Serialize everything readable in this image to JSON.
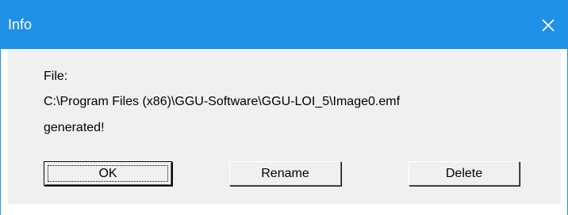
{
  "dialog": {
    "title": "Info",
    "close_icon": "close-icon",
    "message": {
      "label": "File:",
      "path": "C:\\Program Files (x86)\\GGU-Software\\GGU-LOI_5\\Image0.emf",
      "status": "generated!"
    },
    "buttons": {
      "ok": "OK",
      "rename": "Rename",
      "delete": "Delete"
    }
  },
  "colors": {
    "titlebar": "#1e90e6",
    "title_text": "#ffffff",
    "dialog_body": "#f0f0f0"
  }
}
